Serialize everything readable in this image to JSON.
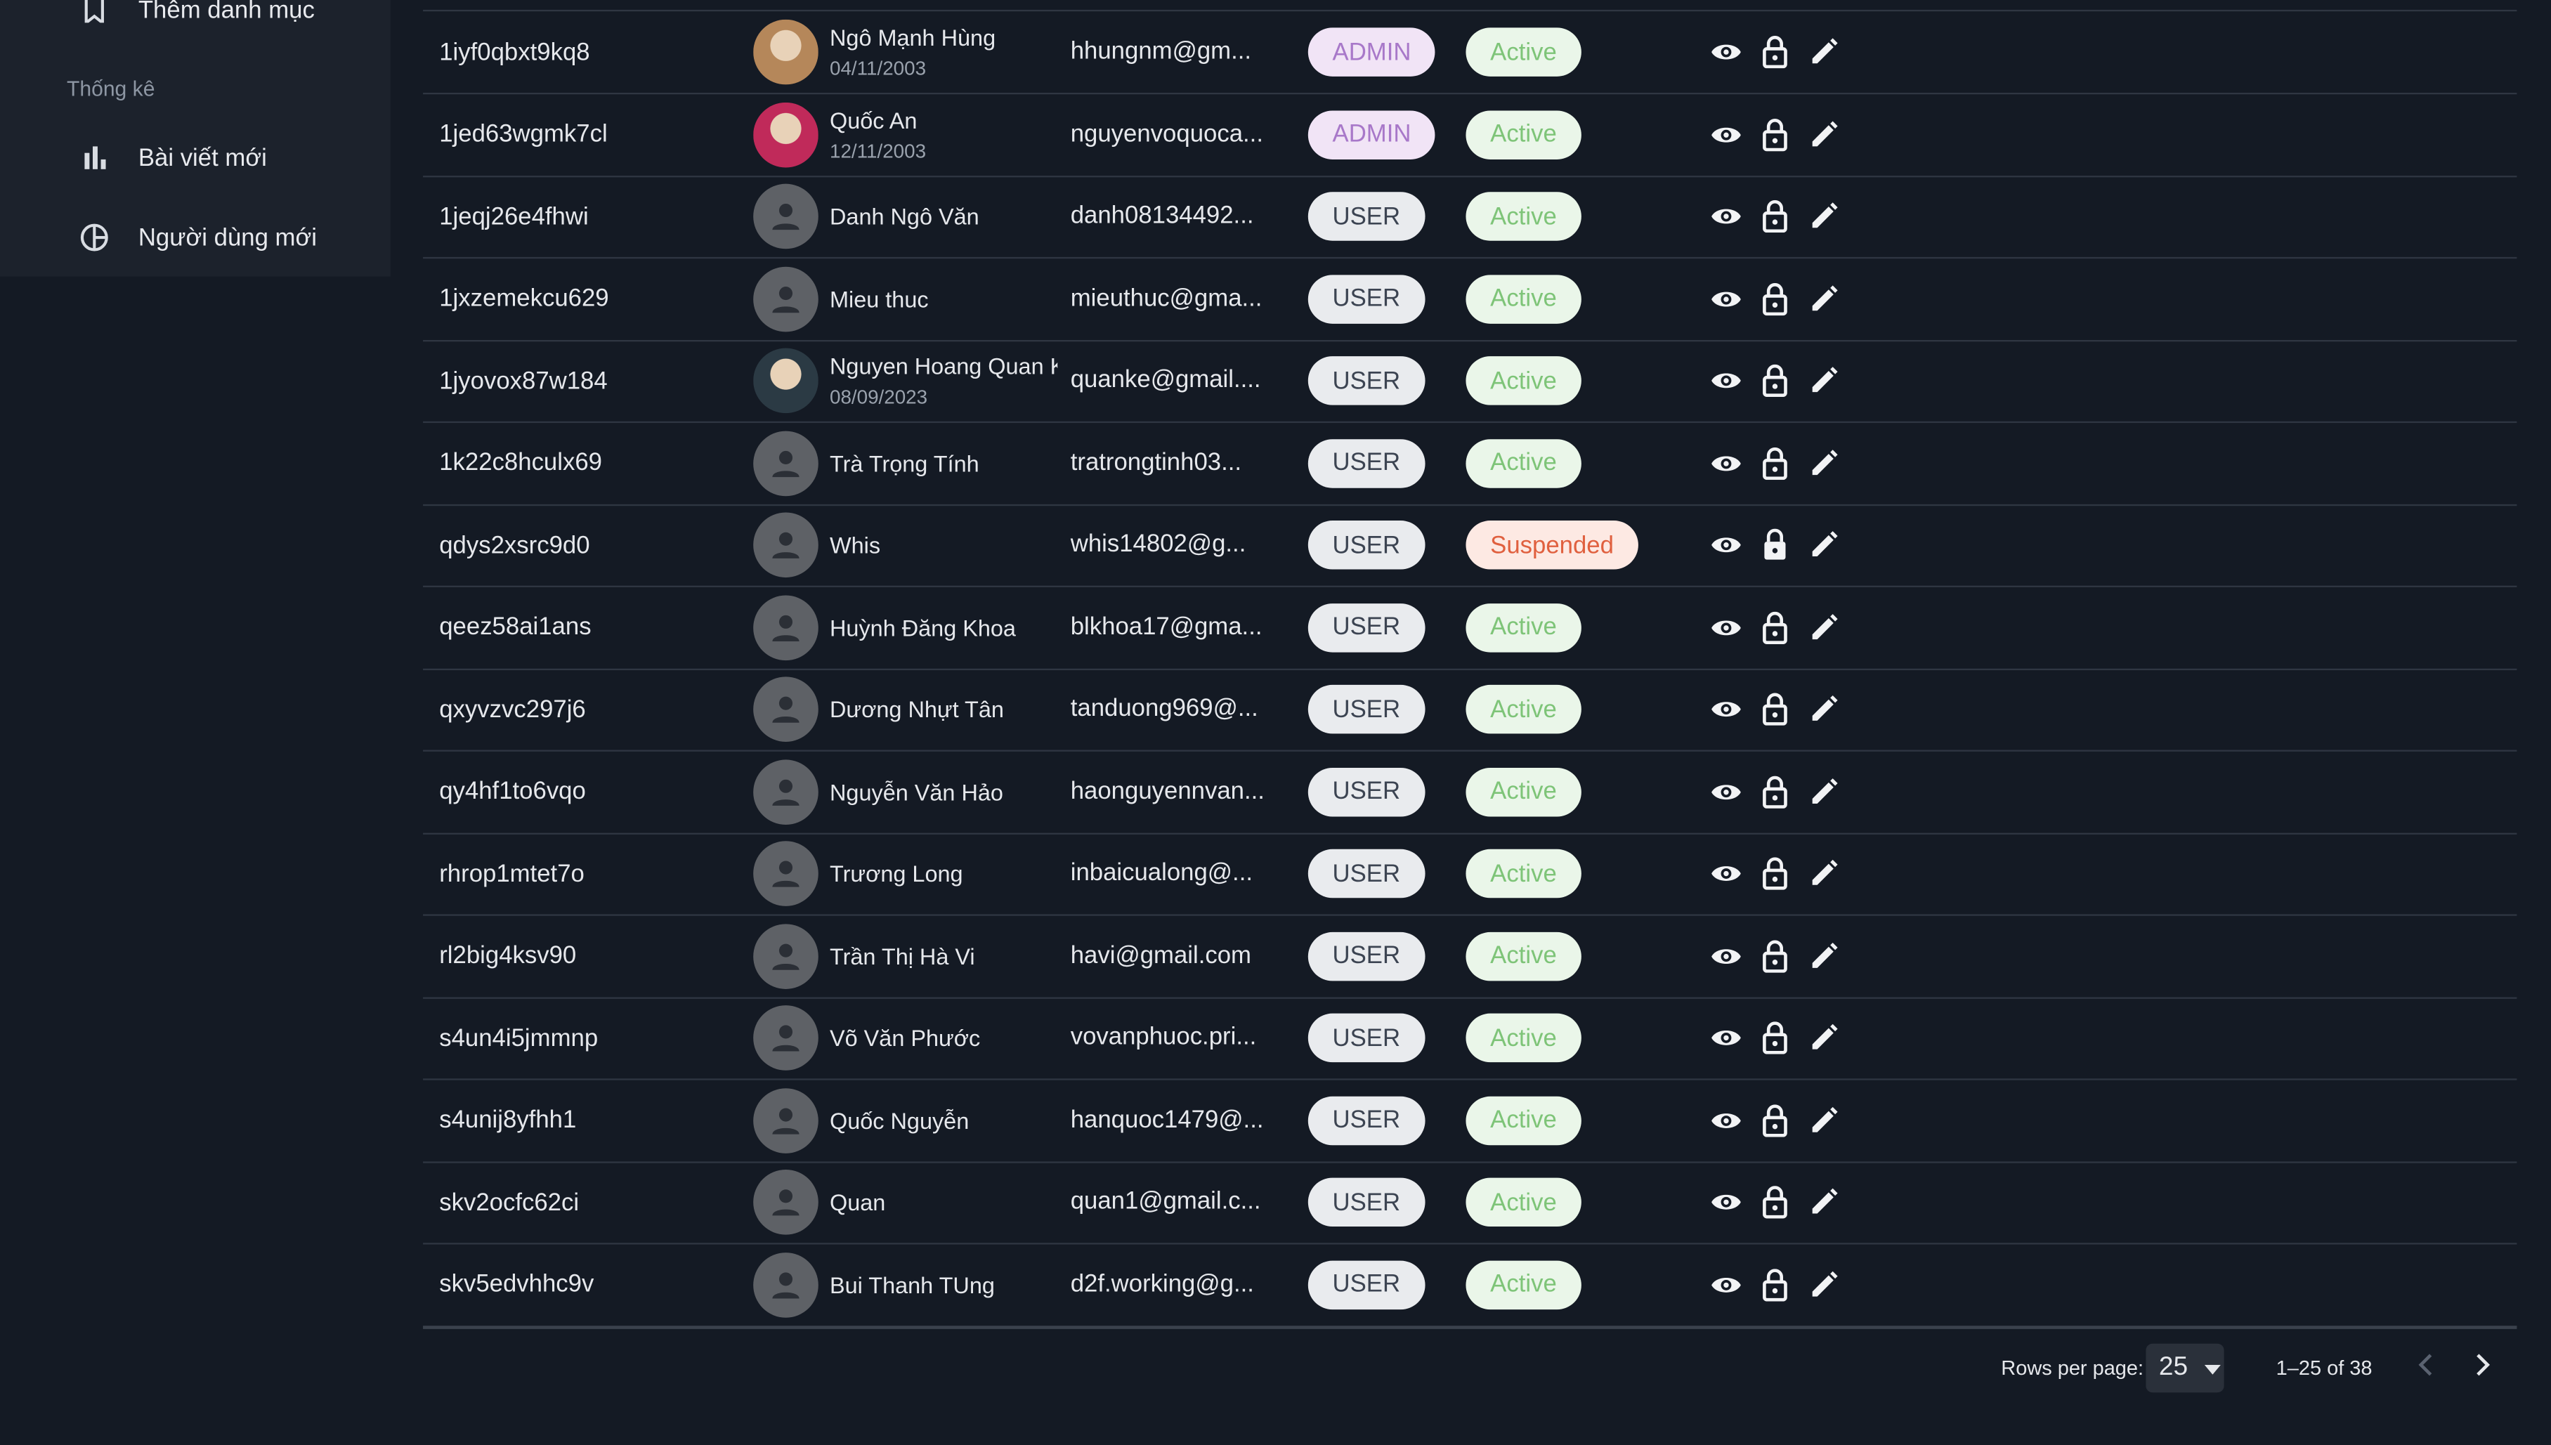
{
  "sidebar": {
    "top_item_label": "Thêm danh mục",
    "section_title": "Thống kê",
    "items": [
      {
        "label": "Bài viết mới",
        "icon": "bar-chart-icon"
      },
      {
        "label": "Người dùng mới",
        "icon": "pie-chart-icon"
      }
    ]
  },
  "users": [
    {
      "id": "1iyf0qbxt9kq8",
      "name": "Ngô Mạnh Hùng",
      "dob": "04/11/2003",
      "email": "hhungnm@gm...",
      "role": "ADMIN",
      "status": "Active",
      "avatar": "photo",
      "avatar_color": "#b5875a"
    },
    {
      "id": "1jed63wgmk7cl",
      "name": "Quốc An",
      "dob": "12/11/2003",
      "email": "nguyenvoquoca...",
      "role": "ADMIN",
      "status": "Active",
      "avatar": "photo",
      "avatar_color": "#c02a5a"
    },
    {
      "id": "1jeqj26e4fhwi",
      "name": "Danh Ngô Văn",
      "dob": "",
      "email": "danh08134492...",
      "role": "USER",
      "status": "Active",
      "avatar": "default"
    },
    {
      "id": "1jxzemekcu629",
      "name": "Mieu thuc",
      "dob": "",
      "email": "mieuthuc@gma...",
      "role": "USER",
      "status": "Active",
      "avatar": "default"
    },
    {
      "id": "1jyovox87w184",
      "name": "Nguyen Hoang Quan Ke",
      "dob": "08/09/2023",
      "email": "quanke@gmail....",
      "role": "USER",
      "status": "Active",
      "avatar": "photo",
      "avatar_color": "#2b3a44"
    },
    {
      "id": "1k22c8hculx69",
      "name": "Trà Trọng Tính",
      "dob": "",
      "email": "tratrongtinh03...",
      "role": "USER",
      "status": "Active",
      "avatar": "default"
    },
    {
      "id": "qdys2xsrc9d0",
      "name": "Whis",
      "dob": "",
      "email": "whis14802@g...",
      "role": "USER",
      "status": "Suspended",
      "avatar": "default"
    },
    {
      "id": "qeez58ai1ans",
      "name": "Huỳnh Đăng Khoa",
      "dob": "",
      "email": "blkhoa17@gma...",
      "role": "USER",
      "status": "Active",
      "avatar": "default"
    },
    {
      "id": "qxyvzvc297j6",
      "name": "Dương Nhựt Tân",
      "dob": "",
      "email": "tanduong969@...",
      "role": "USER",
      "status": "Active",
      "avatar": "default"
    },
    {
      "id": "qy4hf1to6vqo",
      "name": "Nguyễn Văn Hảo",
      "dob": "",
      "email": "haonguyennvan...",
      "role": "USER",
      "status": "Active",
      "avatar": "default"
    },
    {
      "id": "rhrop1mtet7o",
      "name": "Trương Long",
      "dob": "",
      "email": "inbaicualong@...",
      "role": "USER",
      "status": "Active",
      "avatar": "default"
    },
    {
      "id": "rl2big4ksv90",
      "name": "Trần Thị Hà Vi",
      "dob": "",
      "email": "havi@gmail.com",
      "role": "USER",
      "status": "Active",
      "avatar": "default"
    },
    {
      "id": "s4un4i5jmmnp",
      "name": "Võ Văn Phước",
      "dob": "",
      "email": "vovanphuoc.pri...",
      "role": "USER",
      "status": "Active",
      "avatar": "default"
    },
    {
      "id": "s4unij8yfhh1",
      "name": "Quốc Nguyễn",
      "dob": "",
      "email": "hanquoc1479@...",
      "role": "USER",
      "status": "Active",
      "avatar": "default"
    },
    {
      "id": "skv2ocfc62ci",
      "name": "Quan",
      "dob": "",
      "email": "quan1@gmail.c...",
      "role": "USER",
      "status": "Active",
      "avatar": "default"
    },
    {
      "id": "skv5edvhhc9v",
      "name": "Bui Thanh TUng",
      "dob": "",
      "email": "d2f.working@g...",
      "role": "USER",
      "status": "Active",
      "avatar": "default"
    }
  ],
  "pagination": {
    "rows_per_page_label": "Rows per page:",
    "rows_per_page_value": "25",
    "range_label": "1–25 of 38"
  },
  "colors": {
    "background": "#141a24",
    "admin_chip_text": "#a878c9",
    "active_chip_text": "#7ec478",
    "suspended_chip_text": "#e0603f"
  }
}
